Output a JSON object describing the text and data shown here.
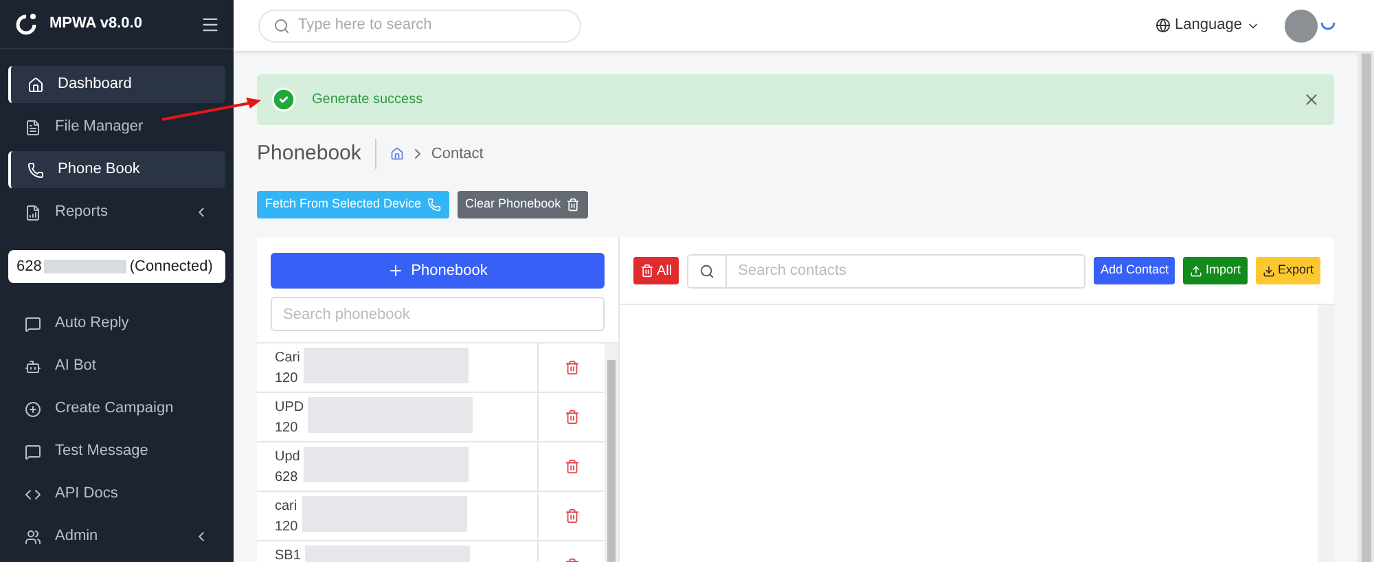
{
  "sidebar": {
    "brand": "MPWA v8.0.0",
    "items_top": [
      {
        "label": "Dashboard",
        "selected": true,
        "expandable": false
      },
      {
        "label": "File Manager",
        "selected": false,
        "expandable": false
      },
      {
        "label": "Phone Book",
        "selected": true,
        "expandable": false
      },
      {
        "label": "Reports",
        "selected": false,
        "expandable": true
      }
    ],
    "device": {
      "number": "628",
      "status": "(Connected)"
    },
    "items_bottom": [
      {
        "label": "Auto Reply",
        "selected": false,
        "expandable": false
      },
      {
        "label": "AI Bot",
        "selected": false,
        "expandable": false
      },
      {
        "label": "Create Campaign",
        "selected": false,
        "expandable": false
      },
      {
        "label": "Test Message",
        "selected": false,
        "expandable": false
      },
      {
        "label": "API Docs",
        "selected": false,
        "expandable": false
      },
      {
        "label": "Admin",
        "selected": false,
        "expandable": true
      }
    ]
  },
  "header": {
    "search_placeholder": "Type here to search",
    "language": "Language"
  },
  "alert": {
    "text": "Generate success"
  },
  "page": {
    "title": "Phonebook",
    "breadcrumb": "Contact"
  },
  "actions": [
    "Fetch From Selected Device",
    "Clear Phonebook"
  ],
  "phonebook_panel": {
    "add_button": "Phonebook",
    "search_placeholder": "Search phonebook",
    "rows": [
      {
        "name": "Cari",
        "number": "120"
      },
      {
        "name": "UPD",
        "number": "120"
      },
      {
        "name": "Upd",
        "number": "628"
      },
      {
        "name": "cari",
        "number": "120"
      },
      {
        "name": "SB1"
      }
    ]
  },
  "contacts_panel": {
    "delete_all": "All",
    "search_placeholder": "Search contacts",
    "add_contact": "Add Contact",
    "import": "Import",
    "export": "Export"
  }
}
